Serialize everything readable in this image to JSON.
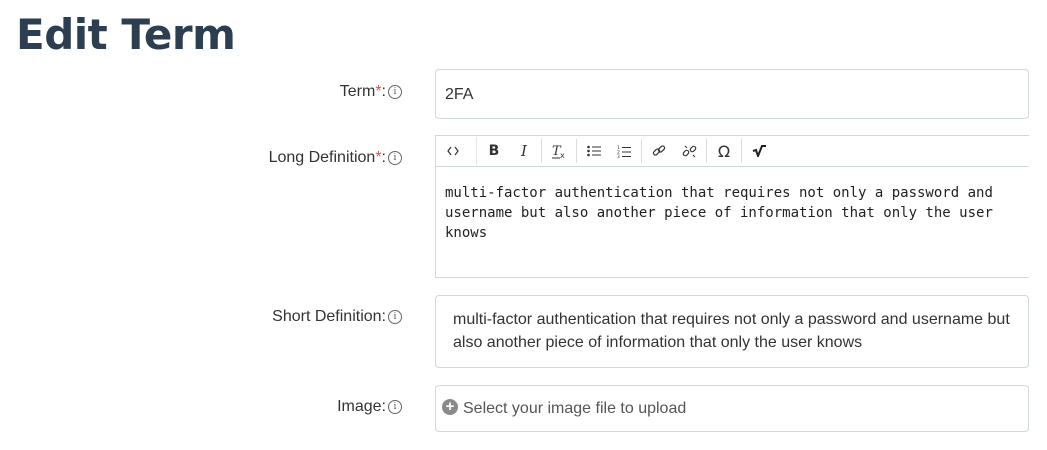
{
  "page": {
    "title": "Edit Term"
  },
  "form": {
    "term": {
      "label": "Term",
      "required_mark": "*",
      "suffix": ":",
      "value": "2FA"
    },
    "long_definition": {
      "label": "Long Definition",
      "required_mark": "*",
      "suffix": ":",
      "value": "multi-factor authentication that requires not only a password and username but also another piece of information that only the user knows",
      "toolbar": [
        {
          "name": "source-icon",
          "glyph": "‹›"
        },
        {
          "name": "bold-icon",
          "glyph": "B"
        },
        {
          "name": "italic-icon",
          "glyph": "I"
        },
        {
          "name": "remove-format-icon",
          "glyph": "Tx"
        },
        {
          "name": "bulleted-list-icon",
          "glyph": "☰"
        },
        {
          "name": "numbered-list-icon",
          "glyph": "☰"
        },
        {
          "name": "link-icon",
          "glyph": "🔗"
        },
        {
          "name": "unlink-icon",
          "glyph": "⛓"
        },
        {
          "name": "special-char-icon",
          "glyph": "Ω"
        },
        {
          "name": "math-icon",
          "glyph": "√"
        }
      ]
    },
    "short_definition": {
      "label": "Short Definition",
      "suffix": ":",
      "value": "multi-factor authentication that requires not only a password and username but also another piece of information that only the user knows"
    },
    "image": {
      "label": "Image",
      "suffix": ":",
      "placeholder": "Select your image file to upload"
    },
    "info_icon_glyph": "i"
  },
  "colors": {
    "title": "#2c3e50",
    "required": "#d9534f",
    "border": "#cfd8dc"
  }
}
